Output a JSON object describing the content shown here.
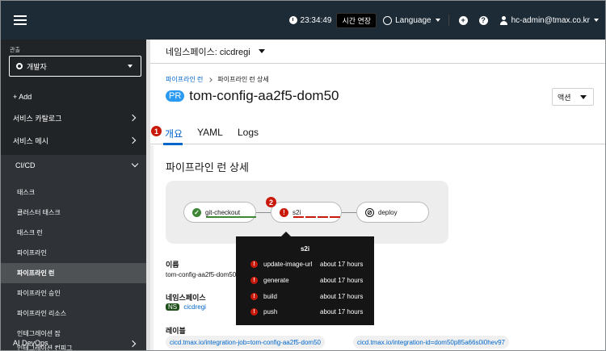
{
  "masthead": {
    "time": "23:34:49",
    "extend_label": "시간 연장",
    "language_label": "Language",
    "user": "hc-admin@tmax.co.kr",
    "plus_icon": "+",
    "help_icon": "?"
  },
  "sidebar": {
    "perspective_label": "관출",
    "perspective_value": "개발자",
    "add_label": "+ Add",
    "items": [
      {
        "label": "서비스 카탈로그"
      },
      {
        "label": "서비스 메시"
      }
    ],
    "section": {
      "label": "CI/CD",
      "sub_items": [
        {
          "label": "태스크"
        },
        {
          "label": "클러스터 태스크"
        },
        {
          "label": "태스크 런"
        },
        {
          "label": "파이프라인"
        },
        {
          "label": "파이프라인 런"
        },
        {
          "label": "파이프라인 승인"
        },
        {
          "label": "파이프라인 리소스"
        },
        {
          "label": "인테그레이션 잡"
        },
        {
          "label": "인테그레이션 컨피그"
        }
      ],
      "active_index": 4
    },
    "ai_label": "AI DevOps"
  },
  "namespace_bar": {
    "label": "네임스페이스: cicdregi"
  },
  "breadcrumb": {
    "link": "파이프라인 런",
    "current": "파이프라인 런 상세"
  },
  "title": {
    "badge": "PR",
    "name": "tom-config-aa2f5-dom50"
  },
  "action_label": "액션",
  "tabs": [
    {
      "label": "개요"
    },
    {
      "label": "YAML"
    },
    {
      "label": "Logs"
    }
  ],
  "callouts": [
    "1",
    "2"
  ],
  "section_title": "파이프라인 런 상세",
  "graph": {
    "tasks": [
      {
        "name": "git-checkout",
        "status": "success",
        "icon": "check-icon"
      },
      {
        "name": "s2i",
        "status": "failed",
        "icon": "error-icon"
      },
      {
        "name": "deploy",
        "status": "cancelled",
        "icon": "ban-icon"
      }
    ],
    "colors": {
      "success": "#3e8635",
      "failed": "#c9190b",
      "cancelled": "#151515"
    }
  },
  "fields": {
    "name_label": "이름",
    "name_value": "tom-config-aa2f5-dom50",
    "namespace_label": "네임스페이스",
    "namespace_badge": "NS",
    "namespace_value": "cicdregi",
    "labels_label": "레이블",
    "labels": [
      "cicd.tmax.io/integration-job=tom-config-aa2f5-dom50",
      "cicd.tmax.io/integration-id=dom50p85a66s0i0hev97"
    ]
  },
  "tooltip": {
    "title": "s2i",
    "steps": [
      {
        "name": "update-image-url",
        "time": "about 17 hours"
      },
      {
        "name": "generate",
        "time": "about 17 hours"
      },
      {
        "name": "build",
        "time": "about 17 hours"
      },
      {
        "name": "push",
        "time": "about 17 hours"
      }
    ]
  }
}
